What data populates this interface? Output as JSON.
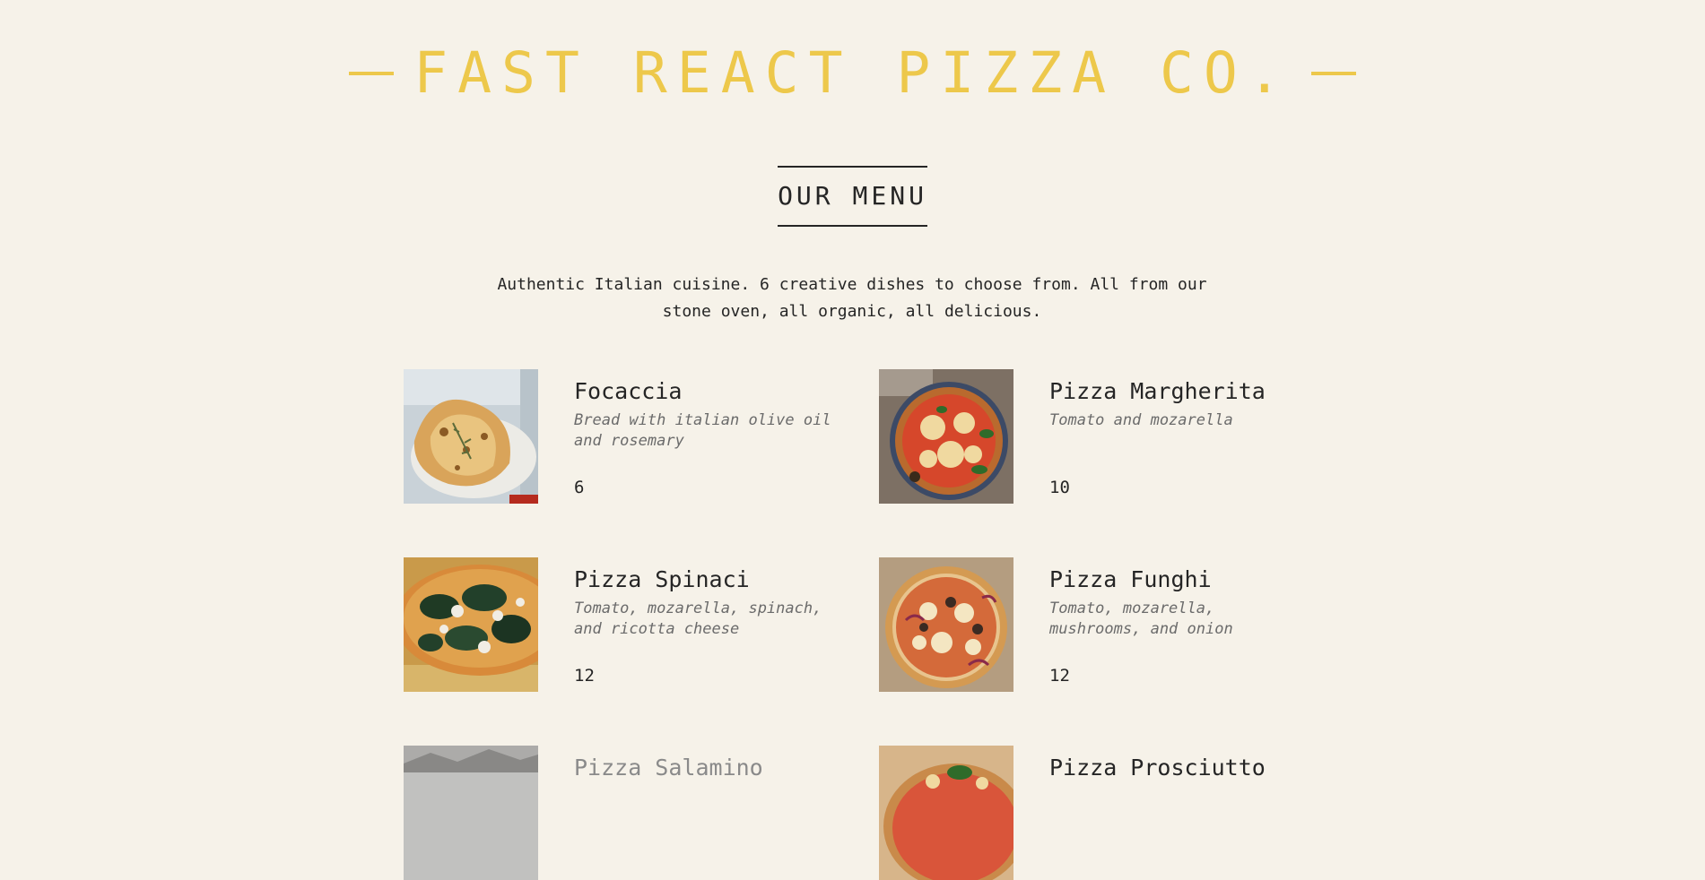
{
  "header": {
    "title": "FAST REACT PIZZA CO."
  },
  "menu": {
    "title": "OUR MENU",
    "intro": "Authentic Italian cuisine. 6 creative dishes to choose from. All from our stone oven, all organic, all delicious."
  },
  "pizzas": [
    {
      "name": "Focaccia",
      "ingredients": "Bread with italian olive oil and rosemary",
      "price": "6",
      "image_icon": "focaccia-photo"
    },
    {
      "name": "Pizza Margherita",
      "ingredients": "Tomato and mozarella",
      "price": "10",
      "image_icon": "pizza-margherita-photo"
    },
    {
      "name": "Pizza Spinaci",
      "ingredients": "Tomato, mozarella, spinach, and ricotta cheese",
      "price": "12",
      "image_icon": "pizza-spinaci-photo"
    },
    {
      "name": "Pizza Funghi",
      "ingredients": "Tomato, mozarella, mushrooms, and onion",
      "price": "12",
      "image_icon": "pizza-funghi-photo"
    },
    {
      "name": "Pizza Salamino",
      "ingredients": "",
      "price": "",
      "image_icon": "pizza-salamino-photo",
      "sold_out": true
    },
    {
      "name": "Pizza Prosciutto",
      "ingredients": "",
      "price": "",
      "image_icon": "pizza-prosciutto-photo"
    }
  ],
  "colors": {
    "background": "#f6f2e9",
    "accent": "#edc84b",
    "text": "#252525",
    "muted": "#6b6b6b"
  }
}
